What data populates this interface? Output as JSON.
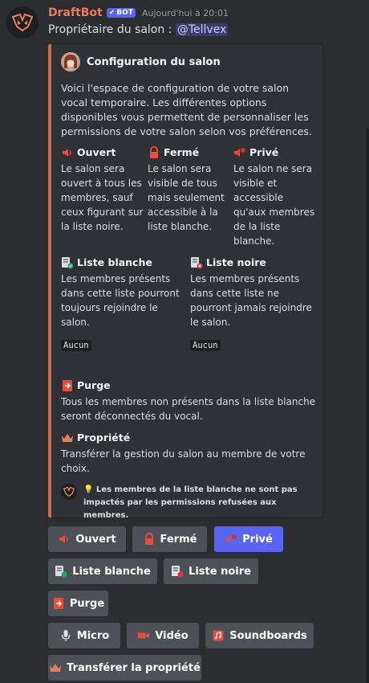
{
  "message": {
    "username": "DraftBot",
    "badge": "BOT",
    "timestamp": "Aujourd'hui à 20:01",
    "owner_prefix": "Propriétaire du salon :",
    "owner_mention": "@Tellvex",
    "avatar_icon": "draftbot-logo-icon"
  },
  "embed": {
    "accent_color": "#d06a4a",
    "author": "Configuration du salon",
    "description": "Voici l'espace de configuration de votre salon vocal temporaire. Les différentes options disponibles vous permettent de personnaliser les permissions de votre salon selon vos préférences.",
    "fields": {
      "open": {
        "name": "Ouvert",
        "value": "Le salon sera ouvert à tous les membres, sauf ceux figurant sur la liste noire.",
        "icon": "speaker-icon"
      },
      "closed": {
        "name": "Fermé",
        "value": "Le salon sera visible de tous mais seulement accessible à la liste blanche.",
        "icon": "lock-icon"
      },
      "private": {
        "name": "Privé",
        "value": "Le salon ne sera visible et accessible qu'aux membres de la liste blanche.",
        "icon": "private-speaker-icon"
      },
      "whitelist": {
        "name": "Liste blanche",
        "value": "Les membres présents dans cette liste pourront toujours rejoindre le salon.",
        "list": "Aucun",
        "icon": "whitelist-icon"
      },
      "blacklist": {
        "name": "Liste noire",
        "value": "Les membres présents dans cette liste ne pourront jamais rejoindre le salon.",
        "list": "Aucun",
        "icon": "blacklist-icon"
      },
      "purge": {
        "name": "Purge",
        "value": "Tous les membres non présents dans la liste blanche seront déconnectés du vocal.",
        "icon": "exit-icon"
      },
      "ownership": {
        "name": "Propriété",
        "value": "Transférer la gestion du salon au membre de votre choix.",
        "icon": "crown-icon"
      }
    },
    "footer": "💡 Les membres de la liste blanche ne sont pas impactés par les permissions refusées aux membres."
  },
  "buttons": {
    "open": "Ouvert",
    "closed": "Fermé",
    "private": "Privé",
    "whitelist": "Liste blanche",
    "blacklist": "Liste noire",
    "purge": "Purge",
    "mic": "Micro",
    "video": "Vidéo",
    "soundboards": "Soundboards",
    "transfer": "Transférer la propriété"
  }
}
